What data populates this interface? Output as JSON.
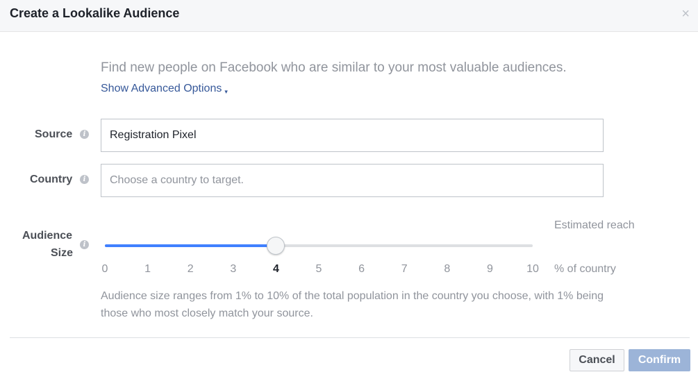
{
  "dialog": {
    "title": "Create a Lookalike Audience",
    "close_glyph": "×",
    "intro": "Find new people on Facebook who are similar to your most valuable audiences.",
    "advanced_link": "Show Advanced Options",
    "advanced_caret": "▾"
  },
  "form": {
    "source": {
      "label": "Source",
      "value": "Registration Pixel"
    },
    "country": {
      "label": "Country",
      "placeholder": "Choose a country to target."
    },
    "audience_size": {
      "label_line1": "Audience",
      "label_line2": "Size",
      "estimated_reach_label": "Estimated reach",
      "ticks": [
        "0",
        "1",
        "2",
        "3",
        "4",
        "5",
        "6",
        "7",
        "8",
        "9",
        "10"
      ],
      "selected": 4,
      "min": 0,
      "max": 10,
      "unit_label": "% of country",
      "help_text": "Audience size ranges from 1% to 10% of the total population in the country you choose, with 1% being those who most closely match your source."
    },
    "info_glyph": "i"
  },
  "footer": {
    "cancel_label": "Cancel",
    "confirm_label": "Confirm"
  },
  "colors": {
    "link": "#365899",
    "slider_fill": "#4080ff",
    "confirm_disabled": "#9cb4d8"
  },
  "icons": {
    "close": "close-icon",
    "info": "info-icon",
    "caret": "chevron-down-icon"
  }
}
